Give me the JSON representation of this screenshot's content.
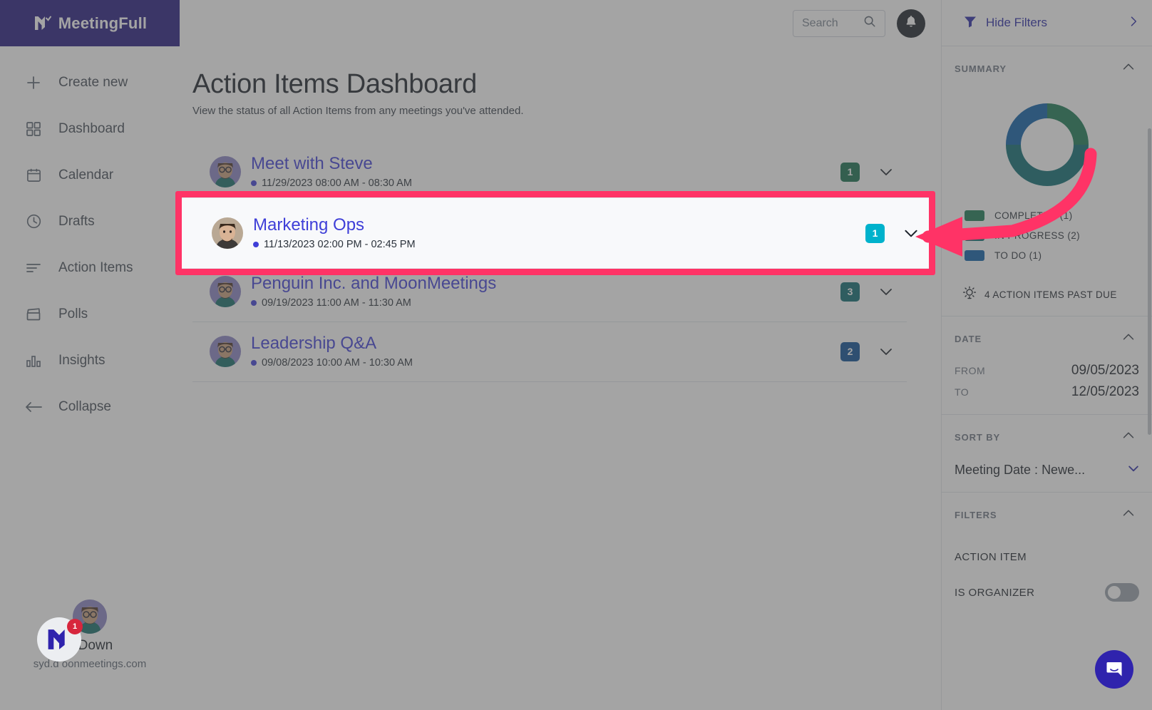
{
  "brand": {
    "name": "MeetingFull"
  },
  "sidebar": {
    "items": [
      {
        "label": "Create new",
        "icon": "plus-icon"
      },
      {
        "label": "Dashboard",
        "icon": "grid-icon"
      },
      {
        "label": "Calendar",
        "icon": "calendar-icon"
      },
      {
        "label": "Drafts",
        "icon": "clock-icon"
      },
      {
        "label": "Action Items",
        "icon": "list-icon"
      },
      {
        "label": "Polls",
        "icon": "clapperboard-icon"
      },
      {
        "label": "Insights",
        "icon": "bar-chart-icon"
      },
      {
        "label": "Collapse",
        "icon": "arrow-left-icon"
      }
    ],
    "user": {
      "name": "d Down",
      "email": "syd.d       oonmeetings.com"
    }
  },
  "topbar": {
    "search_placeholder": "Search",
    "search_value": "",
    "bell_icon": "bell-icon"
  },
  "page": {
    "title": "Action Items Dashboard",
    "subtitle": "View the status of all Action Items from any meetings you've attended."
  },
  "meetings": [
    {
      "title": "Meet with Steve",
      "datetime": "11/29/2023 08:00 AM - 08:30 AM",
      "count": "1",
      "badge_color": "#16704f",
      "avatar": "bitmoji-avatar"
    },
    {
      "title": "Marketing Ops",
      "datetime": "11/13/2023 02:00 PM - 02:45 PM",
      "count": "1",
      "badge_color": "#00b2cc",
      "avatar": "photo-avatar"
    },
    {
      "title": "Penguin Inc. and MoonMeetings",
      "datetime": "09/19/2023 11:00 AM - 11:30 AM",
      "count": "3",
      "badge_color": "#0b6b72",
      "avatar": "bitmoji-avatar"
    },
    {
      "title": "Leadership Q&A",
      "datetime": "09/08/2023 10:00 AM - 10:30 AM",
      "count": "2",
      "badge_color": "#0b4f94",
      "avatar": "bitmoji-avatar"
    }
  ],
  "right_panel": {
    "filters_toggle_label": "Hide Filters",
    "summary": {
      "title": "SUMMARY"
    },
    "past_due": "4 ACTION ITEMS PAST DUE",
    "date": {
      "title": "DATE",
      "from_label": "FROM",
      "from_value": "09/05/2023",
      "to_label": "TO",
      "to_value": "12/05/2023"
    },
    "sort_by": {
      "title": "SORT BY",
      "value": "Meeting Date : Newe..."
    },
    "filters": {
      "title": "FILTERS",
      "rows": [
        {
          "label": "ACTION ITEM",
          "has_toggle": false
        },
        {
          "label": "IS ORGANIZER",
          "has_toggle": true
        }
      ]
    }
  },
  "chart_data": {
    "type": "pie",
    "title": "SUMMARY",
    "labels": [
      "COMPLETED",
      "IN PROGRESS",
      "TO DO"
    ],
    "values": [
      1,
      2,
      1
    ],
    "legend_entries": [
      "COMPLETED (1)",
      "IN PROGRESS (2)",
      "TO DO (1)"
    ],
    "colors": [
      "#1b7a55",
      "#0b6b72",
      "#0b5ea8"
    ],
    "legend_position": "bottom",
    "donut": true,
    "total": 4
  },
  "annotation": {
    "highlight_color": "#ff3366",
    "arrow_color": "#ff3366",
    "target": "Marketing Ops row chevron"
  },
  "floating": {
    "intercom_label": "intercom-chat",
    "badge_count": "1"
  }
}
